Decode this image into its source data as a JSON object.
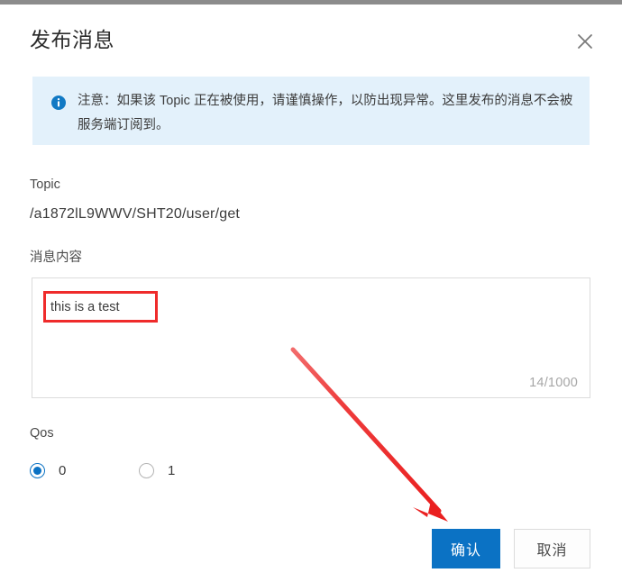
{
  "dialog": {
    "title": "发布消息",
    "close_icon": "close-icon"
  },
  "alert": {
    "icon": "info-circle-icon",
    "text": "注意：如果该 Topic 正在被使用，请谨慎操作，以防出现异常。这里发布的消息不会被服务端订阅到。",
    "background_color": "#e3f1fb",
    "icon_color": "#1179c4"
  },
  "topic_field": {
    "label": "Topic",
    "value": "/a1872lL9WWV/SHT20/user/get"
  },
  "message_field": {
    "label": "消息内容",
    "value": "this is a test",
    "placeholder": "",
    "counter": "14/1000"
  },
  "qos_field": {
    "label": "Qos",
    "options": [
      {
        "label": "0",
        "selected": true
      },
      {
        "label": "1",
        "selected": false
      }
    ]
  },
  "footer": {
    "confirm_label": "确认",
    "cancel_label": "取消",
    "primary_color": "#0b72c4"
  },
  "annotations": {
    "highlight_color": "#ef2b2b",
    "arrow_color": "#ee2b2b",
    "arrow_from": "325,388",
    "arrow_to": "497,578"
  }
}
